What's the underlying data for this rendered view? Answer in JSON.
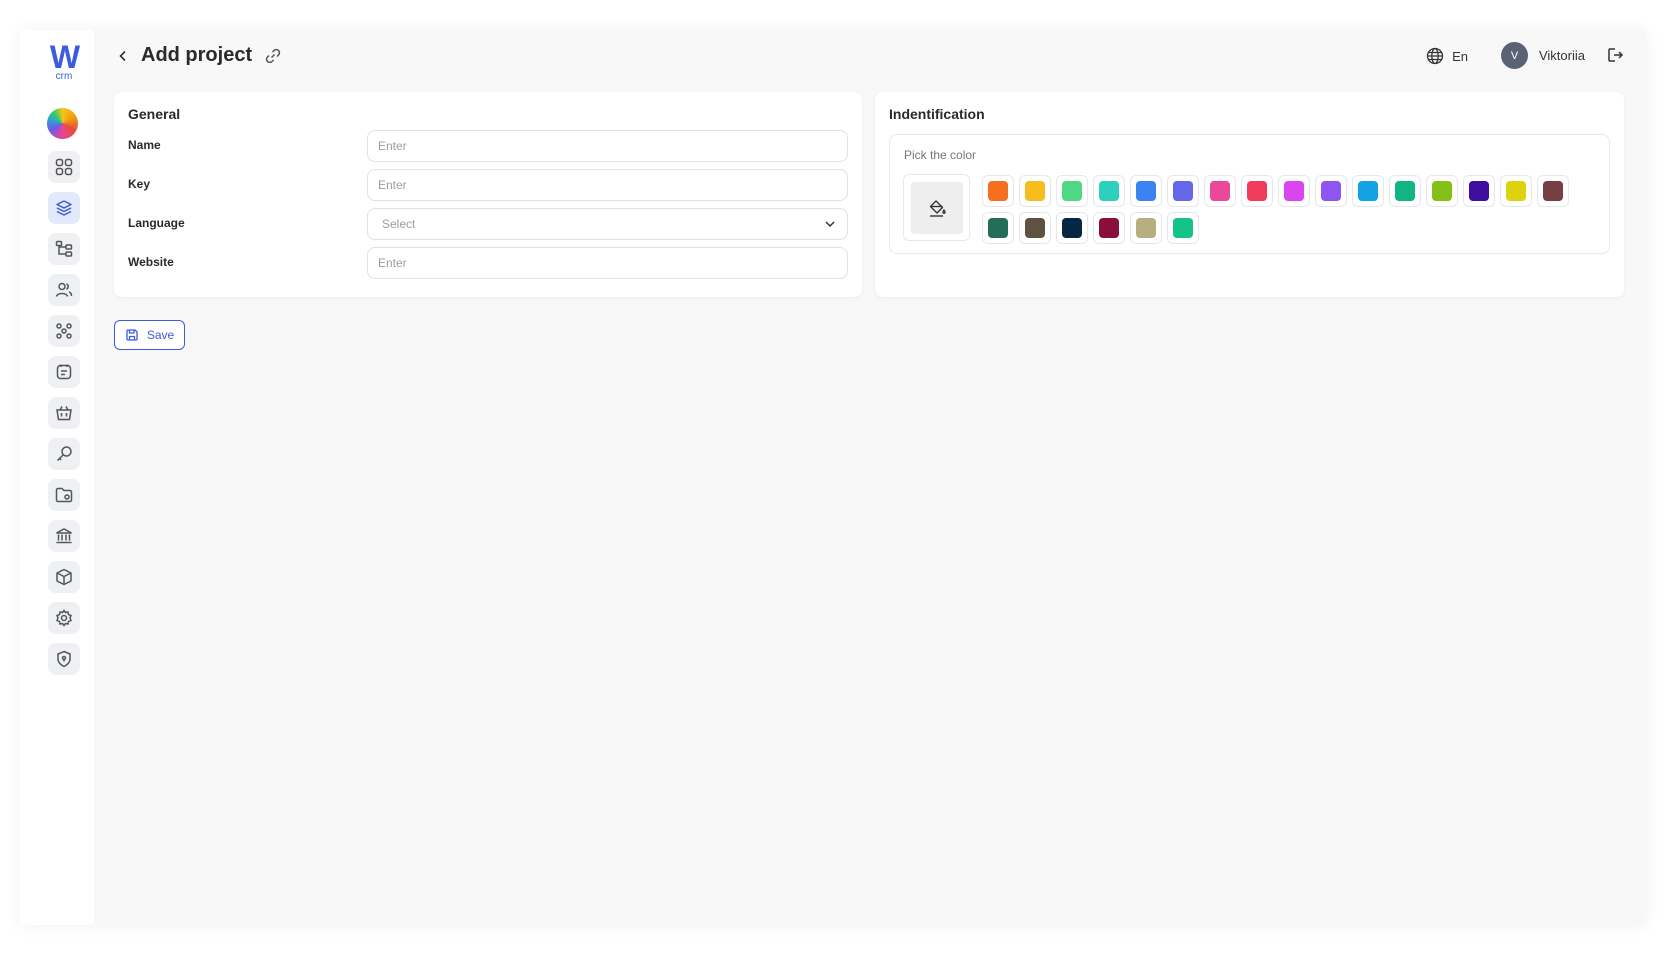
{
  "app": {
    "logo_text": "W",
    "logo_sub": "crm"
  },
  "header": {
    "title": "Add project",
    "language": "En",
    "avatar_initial": "V",
    "username": "Viktoriia"
  },
  "sidebar": {
    "items": [
      {
        "name": "dashboard",
        "icon": "grid-icon",
        "active": false
      },
      {
        "name": "projects",
        "icon": "layers-icon",
        "active": true
      },
      {
        "name": "structure",
        "icon": "hierarchy-icon",
        "active": false
      },
      {
        "name": "users",
        "icon": "users-icon",
        "active": false
      },
      {
        "name": "teams",
        "icon": "team-icon",
        "active": false
      },
      {
        "name": "notes",
        "icon": "notes-icon",
        "active": false
      },
      {
        "name": "shop",
        "icon": "basket-icon",
        "active": false
      },
      {
        "name": "keys",
        "icon": "key-icon",
        "active": false
      },
      {
        "name": "files",
        "icon": "folder-icon",
        "active": false
      },
      {
        "name": "bank",
        "icon": "bank-icon",
        "active": false
      },
      {
        "name": "products",
        "icon": "box-icon",
        "active": false
      },
      {
        "name": "settings",
        "icon": "gear-icon",
        "active": false
      },
      {
        "name": "security",
        "icon": "shield-icon",
        "active": false
      }
    ]
  },
  "general": {
    "title": "General",
    "fields": {
      "name": {
        "label": "Name",
        "placeholder": "Enter",
        "value": ""
      },
      "key": {
        "label": "Key",
        "placeholder": "Enter",
        "value": ""
      },
      "language": {
        "label": "Language",
        "placeholder": "Select",
        "value": ""
      },
      "website": {
        "label": "Website",
        "placeholder": "Enter",
        "value": ""
      }
    }
  },
  "identification": {
    "title": "Indentification",
    "picker_label": "Pick the color",
    "colors": [
      "#f5701e",
      "#f6bd1c",
      "#4ed784",
      "#2dcfbd",
      "#3a83f0",
      "#6567ea",
      "#eb4899",
      "#f03b5a",
      "#d946ef",
      "#8f55f0",
      "#13a2e6",
      "#11b483",
      "#84c117",
      "#3e0f9f",
      "#dcd30c",
      "#773f44",
      "#246d56",
      "#5f5241",
      "#062641",
      "#8a0d3a",
      "#b7af80",
      "#15c289"
    ]
  },
  "actions": {
    "save_label": "Save"
  }
}
